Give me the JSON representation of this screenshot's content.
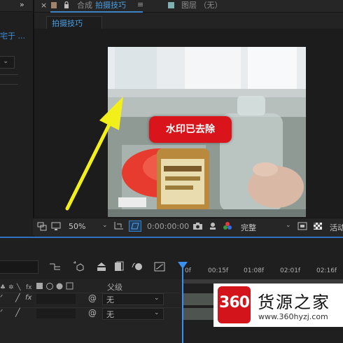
{
  "header": {
    "comp_tab_prefix": "合成",
    "comp_tab_name": "拍摄技巧",
    "layer_tab": "图层 （无）",
    "breadcrumb": "拍摄技巧",
    "left_link": "宅于 ...",
    "close_glyph": "×",
    "menu_glyph": "≡",
    "expand_glyph": "»"
  },
  "viewer": {
    "watermark_label": "水印已去除",
    "zoom": "50%",
    "timecode": "0:00:00:00",
    "resolution": "完整",
    "active_camera": "活动"
  },
  "timeline": {
    "parent_header": "父级",
    "ruler_labels": [
      "0f",
      "00:15f",
      "01:08f",
      "02:01f",
      "02:16f"
    ],
    "rows": [
      {
        "parent": "无"
      },
      {
        "parent": "无"
      }
    ]
  },
  "overlay": {
    "badge": "360",
    "brand": "货源之家",
    "url": "www.360hyzj.com"
  },
  "colors": {
    "accent_blue": "#3b8ff0",
    "tab_blue": "#4a9fe3",
    "watermark_red": "#d9141a",
    "arrow_yellow": "#f2ef1a",
    "logo_red": "#d3151b"
  },
  "icons": [
    "expand-icon",
    "close-icon",
    "lock-icon",
    "menu-icon",
    "monitor-icon",
    "grid-icon",
    "region-icon",
    "camera-icon",
    "color-icon",
    "checker-icon",
    "graph-icon",
    "shy-icon"
  ]
}
